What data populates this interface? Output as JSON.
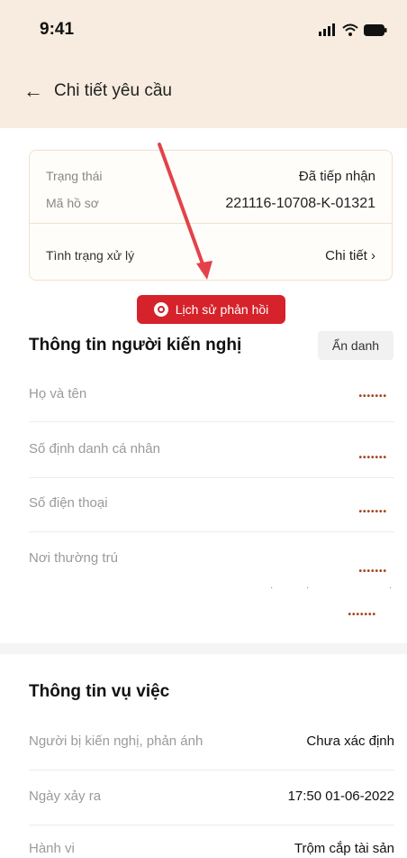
{
  "status_bar": {
    "time": "9:41"
  },
  "nav": {
    "title": "Chi tiết yêu cầu"
  },
  "status_card": {
    "status_label": "Trạng thái",
    "status_value": "Đã tiếp nhận",
    "file_label": "Mã hồ sơ",
    "file_value": "221116-10708-K-01321",
    "processing_label": "Tình trạng xử lý",
    "detail_link": "Chi tiết"
  },
  "history_button": {
    "label": "Lịch sử phản hồi"
  },
  "petitioner": {
    "title": "Thông tin người kiến nghị",
    "anonymous_badge": "Ẩn danh",
    "fields": [
      {
        "label": "Họ và tên",
        "value": "•••••••"
      },
      {
        "label": "Số định danh cá nhân",
        "value": "•••••••"
      },
      {
        "label": "Số điện thoại",
        "value": "•••••••"
      },
      {
        "label": "Nơi thường trú",
        "value": "•••••••",
        "value2": "•••••••"
      }
    ]
  },
  "case_info": {
    "title": "Thông tin vụ việc",
    "rows": [
      {
        "label": "Người bị kiến nghị, phản ánh",
        "value": "Chưa xác định"
      },
      {
        "label": "Ngày xảy ra",
        "value": "17:50 01-06-2022"
      },
      {
        "label": "Hành vi",
        "value": "Trộm cắp tài sản"
      }
    ]
  },
  "colors": {
    "header_bg": "#f7ecdf",
    "accent_red": "#d6222a",
    "mask_color": "#a5451e"
  }
}
